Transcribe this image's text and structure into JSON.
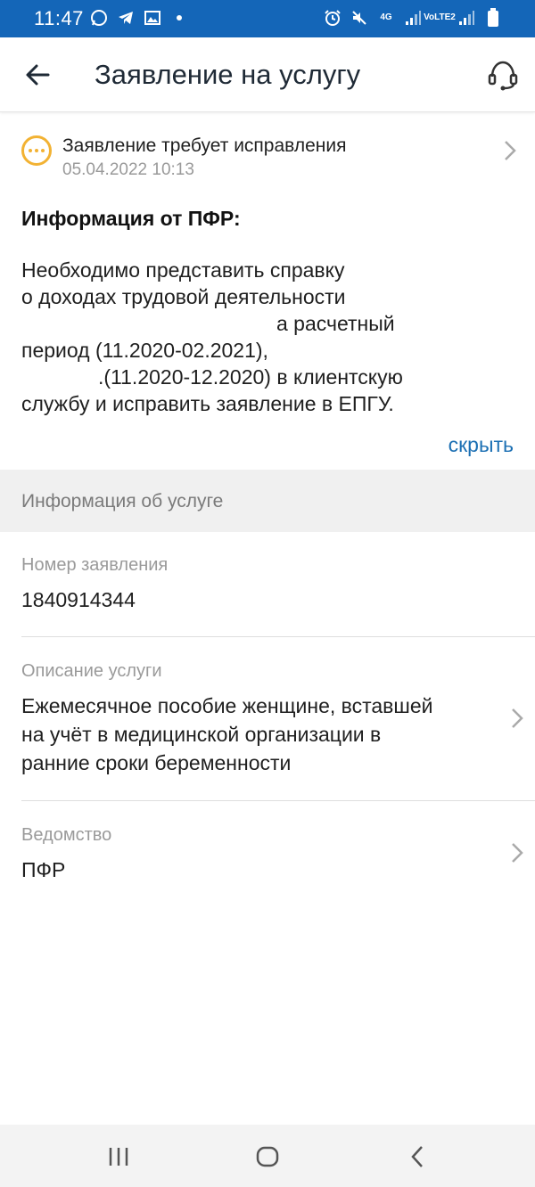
{
  "status_bar": {
    "time": "11:47",
    "left_icons": [
      "whatsapp-icon",
      "telegram-icon",
      "gallery-icon"
    ],
    "network": "4G",
    "volte": "VoLTE2"
  },
  "header": {
    "title": "Заявление на услугу",
    "back_icon": "arrow-left-icon",
    "support_icon": "headset-icon"
  },
  "status": {
    "title": "Заявление требует исправления",
    "date": "05.04.2022 10:13",
    "accent_color": "#f2b233"
  },
  "info": {
    "heading": "Информация от ПФР:",
    "lines": [
      "Необходимо представить справку",
      "о доходах трудовой деятельности",
      "а расчетный",
      "период (11.2020-02.2021),",
      ".(11.2020-12.2020) в клиентскую",
      "службу и исправить заявление в ЕПГУ."
    ],
    "hide_label": "скрыть"
  },
  "service_section": {
    "header": "Информация об услуге",
    "fields": [
      {
        "label": "Номер заявления",
        "value": "1840914344"
      },
      {
        "label": "Описание услуги",
        "value_lines": [
          "Ежемесячное пособие женщине, вставшей",
          "на учёт в медицинской организации в",
          "ранние сроки беременности"
        ]
      },
      {
        "label": "Ведомство",
        "value": "ПФР"
      }
    ]
  },
  "colors": {
    "status_bar": "#1466b8",
    "link": "#1b6fb3",
    "warning": "#f2b233"
  }
}
